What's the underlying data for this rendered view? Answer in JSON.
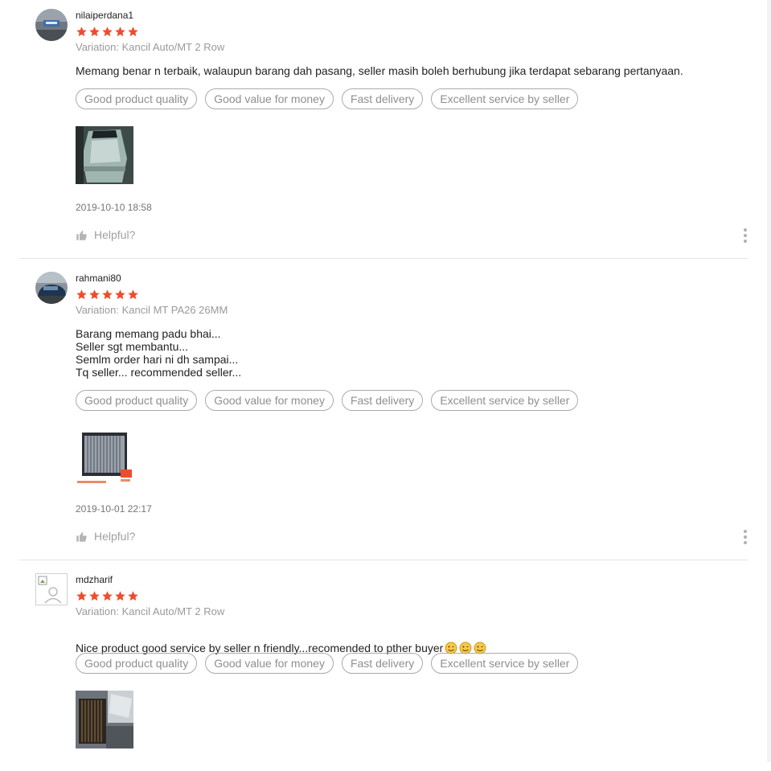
{
  "reviews": [
    {
      "username": "nilaiperdana1",
      "rating": 5,
      "variation": "Variation: Kancil Auto/MT 2 Row",
      "comment": "Memang benar n terbaik, walaupun barang dah pasang, seller masih boleh berhubung jika terdapat sebarang pertanyaan.",
      "tags": [
        "Good product quality",
        "Good value for money",
        "Fast delivery",
        "Excellent service by seller"
      ],
      "timestamp": "2019-10-10 18:58",
      "helpful_label": "Helpful?",
      "avatar_icon": "avatar-photo-icon",
      "photo_icon": "car-roof-photo"
    },
    {
      "username": "rahmani80",
      "rating": 5,
      "variation": "Variation: Kancil MT PA26 26MM",
      "comment": "Barang memang padu bhai...\nSeller sgt membantu...\nSemlm order hari ni dh sampai...\nTq seller... recommended seller...",
      "tags": [
        "Good product quality",
        "Good value for money",
        "Fast delivery",
        "Excellent service by seller"
      ],
      "timestamp": "2019-10-01 22:17",
      "helpful_label": "Helpful?",
      "avatar_icon": "avatar-car-icon",
      "photo_icon": "radiator-photo"
    },
    {
      "username": "mdzharif",
      "rating": 5,
      "variation": "Variation: Kancil Auto/MT 2 Row",
      "comment": "Nice product good service by seller n friendly...recomended to pther buyer",
      "emoji_count": 3,
      "tags": [
        "Good product quality",
        "Good value for money",
        "Fast delivery",
        "Excellent service by seller"
      ],
      "avatar_icon": "broken-avatar-icon",
      "photo_icon": "installed-radiator-photo"
    }
  ],
  "colors": {
    "star": "#ee4d2d",
    "tag_border": "#aaaaaa",
    "muted_text": "#9a9a9a"
  }
}
